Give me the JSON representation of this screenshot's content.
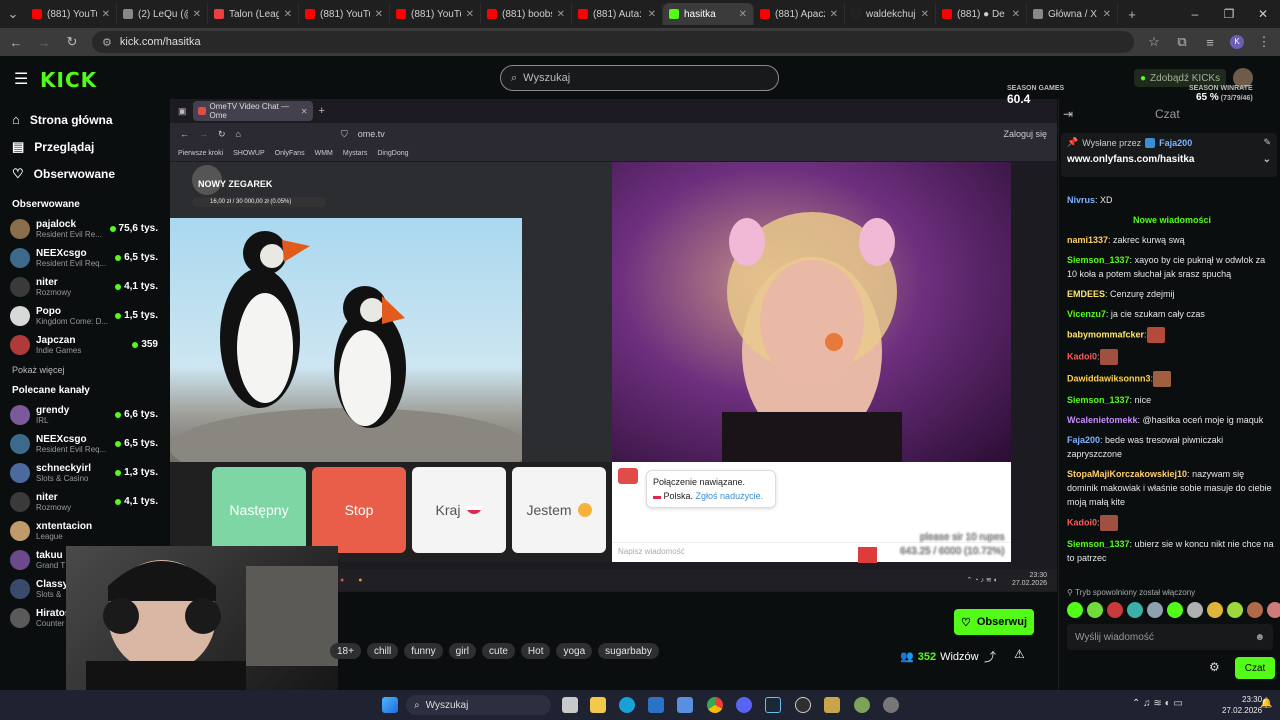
{
  "browser": {
    "tabs": [
      {
        "title": "(881) YouTub",
        "color": "#ff0000"
      },
      {
        "title": "(2) LeQu (@",
        "color": "#888888"
      },
      {
        "title": "Talon (Leagu",
        "color": "#e94141"
      },
      {
        "title": "(881) YouTub",
        "color": "#ff0000"
      },
      {
        "title": "(881) YouTub",
        "color": "#ff0000"
      },
      {
        "title": "(881) boobs",
        "color": "#ff0000"
      },
      {
        "title": "(881) Auta: E",
        "color": "#ff0000"
      },
      {
        "title": "hasitka",
        "color": "#53fc18",
        "active": true
      },
      {
        "title": "(881) Apacz",
        "color": "#ff0000"
      },
      {
        "title": "waldekchuj",
        "color": "#222222"
      },
      {
        "title": "(881) ● De",
        "color": "#ff0000"
      },
      {
        "title": "Główna / X",
        "color": "#888888"
      }
    ],
    "url": "kick.com/hasitka",
    "profile_initial": "K"
  },
  "header": {
    "logo": "KICK",
    "search_placeholder": "Wyszukaj",
    "earn_label": "Zdobądź KICKs"
  },
  "sidebar": {
    "nav": [
      {
        "label": "Strona główna",
        "icon": "home-icon"
      },
      {
        "label": "Przeglądaj",
        "icon": "browse-icon"
      },
      {
        "label": "Obserwowane",
        "icon": "heart-icon"
      }
    ],
    "followed_title": "Obserwowane",
    "followed": [
      {
        "name": "pajalock",
        "category": "Resident Evil Re...",
        "viewers": "75,6 tys.",
        "color": "#8a6d4a"
      },
      {
        "name": "NEEXcsgo",
        "category": "Resident Evil Req...",
        "viewers": "6,5 tys.",
        "color": "#3d6a8a"
      },
      {
        "name": "niter",
        "category": "Rozmowy",
        "viewers": "4,1 tys.",
        "color": "#3a3a3a"
      },
      {
        "name": "Popo",
        "category": "Kingdom Come: D...",
        "viewers": "1,5 tys.",
        "color": "#d8d8d8"
      },
      {
        "name": "Japczan",
        "category": "Indie Games",
        "viewers": "359",
        "color": "#b03a3a"
      }
    ],
    "show_more": "Pokaż więcej",
    "recommended_title": "Polecane kanały",
    "recommended": [
      {
        "name": "grendy",
        "category": "IRL",
        "viewers": "6,6 tys.",
        "color": "#7a5a9a"
      },
      {
        "name": "NEEXcsgo",
        "category": "Resident Evil Req...",
        "viewers": "6,5 tys.",
        "color": "#3d6a8a"
      },
      {
        "name": "schneckyirl",
        "category": "Slots & Casino",
        "viewers": "1,3 tys.",
        "color": "#4a6aa0"
      },
      {
        "name": "niter",
        "category": "Rozmowy",
        "viewers": "4,1 tys.",
        "color": "#3a3a3a"
      },
      {
        "name": "xntentacion",
        "category": "League",
        "viewers": "",
        "color": "#c09a6a"
      },
      {
        "name": "takuu",
        "category": "Grand T",
        "viewers": "",
        "color": "#6a4a8a"
      },
      {
        "name": "Classy",
        "category": "Slots &",
        "viewers": "",
        "color": "#3a4a6a"
      },
      {
        "name": "Hiratos",
        "category": "Counter",
        "viewers": "",
        "color": "#5a5a5a"
      }
    ]
  },
  "stream": {
    "inner_tab": "OmeTV Video Chat — Ome",
    "inner_url": "ome.tv",
    "inner_login": "Zaloguj się",
    "bookmarks": [
      "Pierwsze kroki",
      "SHOWUP",
      "OnlyFans",
      "WMM",
      "Mystars",
      "DingDong"
    ],
    "overlay_title": "NOWY ZEGAREK",
    "overlay_progress": "16,00 zł / 30 000,00 zł (0.05%)",
    "buttons": {
      "next": "Następny",
      "stop": "Stop",
      "country": "Kraj",
      "gender": "Jestem"
    },
    "connect_line1": "Połączenie nawiązane.",
    "connect_country": "Polska.",
    "connect_report": "Zgłoś nadużycie.",
    "msg_placeholder": "Napisz wiadomość",
    "goal_line1": "please sir 10 rupes",
    "goal_line2": "643.25 / 6000 (10.72%)",
    "goal_progress": 0.1072,
    "inner_clock": "23:30",
    "inner_date": "27.02.2026"
  },
  "info": {
    "tags": [
      "18+",
      "chill",
      "funny",
      "girl",
      "cute",
      "Hot",
      "yoga",
      "sugarbaby"
    ],
    "follow_label": "Obserwuj",
    "viewers_count": "352",
    "viewers_label": "Widzów"
  },
  "chat": {
    "season_games_label": "SEASON GAMES",
    "season_games": "60.4",
    "season_winrate_label": "SEASON WINRATE",
    "season_winrate": "65 %",
    "season_winrate_detail": "(73/79/46)",
    "title": "Czat",
    "pinned_by_label": "Wysłane przez",
    "pinned_by_user": "Faja200",
    "pinned_link": "www.onlyfans.com/hasitka",
    "new_messages": "Nowe wiadomości",
    "messages": [
      {
        "user": "Nivrus",
        "text": " XD",
        "color": "#7fb3ff",
        "emote": ""
      },
      {
        "user": "nami1337",
        "text": " zakrec kurwą swą",
        "color": "#ffcf6a",
        "emote": ""
      },
      {
        "user": "Siemson_1337",
        "text": " xayoo by cie puknął w odwlok za 10 koła a potem słuchał jak srasz spuchą",
        "color": "#53fc18",
        "emote": ""
      },
      {
        "user": "EMDEES",
        "text": " Cenzurę zdejmij",
        "color": "#ffe66a",
        "emote": ""
      },
      {
        "user": "Vicenzu7",
        "text": " ja cie szukam cały czas",
        "color": "#53fc18",
        "emote": ""
      },
      {
        "user": "babymommafcker",
        "text": " ",
        "color": "#ffe66a",
        "emote": "#b34a3a"
      },
      {
        "user": "Kadoi0",
        "text": " ",
        "color": "#ff5a5a",
        "emote": "#a05040"
      },
      {
        "user": "Dawiddawiksonnn3",
        "text": " ",
        "color": "#ffd24a",
        "emote": "#a06040"
      },
      {
        "user": "Siemson_1337",
        "text": " nice",
        "color": "#53fc18",
        "emote": ""
      },
      {
        "user": "Wcalenietomekk",
        "text": " @hasitka oceń moje ig maquk",
        "color": "#c88aff",
        "emote": ""
      },
      {
        "user": "Faja200",
        "text": " bede was tresował piwniczaki zapryszczone",
        "color": "#7fb3ff",
        "emote": ""
      },
      {
        "user": "StopaMajiKorczakowskiej10",
        "text": " nazywam się dominik makowiak i właśnie sobie masuje do ciebie moją małą kite",
        "color": "#ffcf6a",
        "emote": ""
      },
      {
        "user": "Kadoi0",
        "text": " ",
        "color": "#ff5a5a",
        "emote": "#a05040"
      },
      {
        "user": "Siemson_1337",
        "text": " ubierz sie w koncu nikt nie chce na to patrzec",
        "color": "#53fc18",
        "emote": ""
      }
    ],
    "slowmode": "Tryb spowolniony został włączony",
    "input_placeholder": "Wyślij wiadomość",
    "send_label": "Czat"
  },
  "taskbar": {
    "search": "Wyszukaj",
    "time": "23:30",
    "date": "27.02.2026"
  }
}
